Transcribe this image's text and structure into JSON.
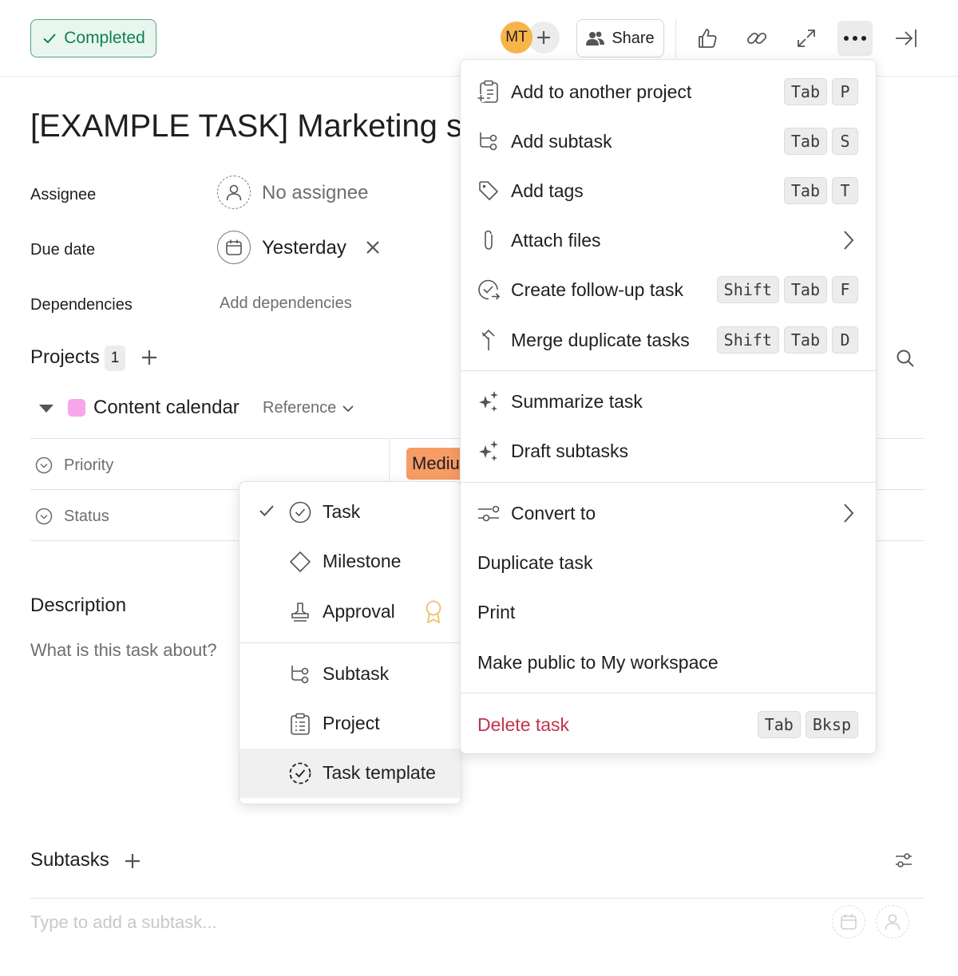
{
  "topbar": {
    "completed_label": "Completed",
    "avatar_initials": "MT",
    "share_label": "Share"
  },
  "task": {
    "title": "[EXAMPLE TASK] Marketing s",
    "fields": {
      "assignee_label": "Assignee",
      "assignee_value": "No assignee",
      "due_date_label": "Due date",
      "due_date_value": "Yesterday",
      "dependencies_label": "Dependencies",
      "dependencies_action": "Add dependencies"
    },
    "projects": {
      "title": "Projects",
      "count": "1",
      "project_name": "Content calendar",
      "section_name": "Reference",
      "swatch_color": "#f7a6ea"
    },
    "properties": {
      "priority_label": "Priority",
      "priority_value": "Medium",
      "priority_color": "#f79c64",
      "status_label": "Status"
    },
    "description": {
      "title": "Description",
      "placeholder": "What is this task about?"
    },
    "subtasks": {
      "title": "Subtasks",
      "placeholder": "Type to add a subtask..."
    }
  },
  "main_menu": {
    "items": [
      {
        "label": "Add to another project",
        "keys": [
          "Tab",
          "P"
        ]
      },
      {
        "label": "Add subtask",
        "keys": [
          "Tab",
          "S"
        ]
      },
      {
        "label": "Add tags",
        "keys": [
          "Tab",
          "T"
        ]
      },
      {
        "label": "Attach files"
      },
      {
        "label": "Create follow-up task",
        "keys": [
          "Shift",
          "Tab",
          "F"
        ]
      },
      {
        "label": "Merge duplicate tasks",
        "keys": [
          "Shift",
          "Tab",
          "D"
        ]
      },
      {
        "label": "Summarize task"
      },
      {
        "label": "Draft subtasks"
      },
      {
        "label": "Convert to"
      },
      {
        "label": "Duplicate task"
      },
      {
        "label": "Print"
      },
      {
        "label": "Make public to My workspace"
      },
      {
        "label": "Delete task",
        "keys": [
          "Tab",
          "Bksp"
        ]
      }
    ],
    "danger_color": "#c0334c"
  },
  "convert_menu": {
    "items": [
      {
        "label": "Task",
        "selected": true
      },
      {
        "label": "Milestone"
      },
      {
        "label": "Approval"
      },
      {
        "label": "Subtask"
      },
      {
        "label": "Project"
      },
      {
        "label": "Task template",
        "highlighted": true
      }
    ]
  }
}
